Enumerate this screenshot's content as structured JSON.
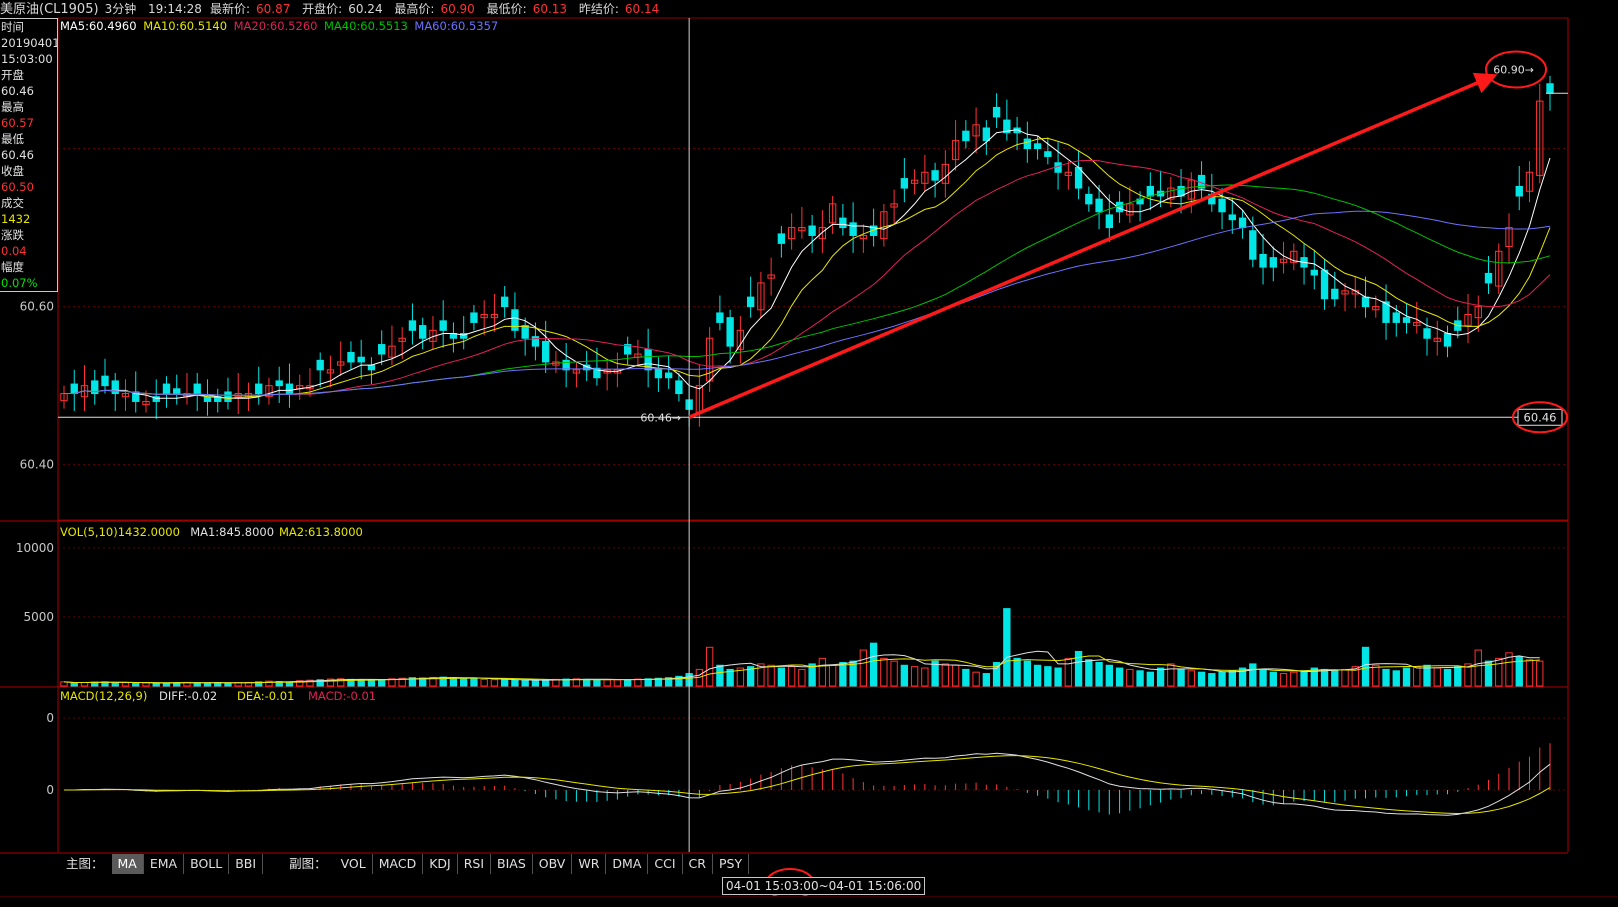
{
  "header": {
    "symbol": "美原油(CL1905)",
    "period": "3分钟",
    "clock": "19:14:28",
    "latest_label": "最新价:",
    "latest_value": "60.87",
    "open_label": "开盘价:",
    "open_value": "60.24",
    "high_label": "最高价:",
    "high_value": "60.90",
    "low_label": "最低价:",
    "low_value": "60.13",
    "prev_label": "昨结价:",
    "prev_value": "60.14"
  },
  "infobox": {
    "time_label": "时间",
    "date": "20190401",
    "time": "15:03:00",
    "open_label": "开盘",
    "open": "60.46",
    "high_label": "最高",
    "high": "60.57",
    "low_label": "最低",
    "low": "60.46",
    "close_label": "收盘",
    "close": "60.50",
    "vol_label": "成交",
    "vol": "1432",
    "chg_label": "涨跌",
    "chg": "0.04",
    "pct_label": "幅度",
    "pct": "0.07%"
  },
  "indicators": {
    "ma_line": [
      "MA5:60.4960",
      "MA10:60.5140",
      "MA20:60.5260",
      "MA40:60.5513",
      "MA60:60.5357"
    ],
    "vol_line": [
      "VOL(5,10)1432.0000",
      "MA1:845.8000",
      "MA2:613.8000"
    ],
    "macd_line": [
      "MACD(12,26,9)",
      "DIFF:-0.02",
      "DEA:-0.01",
      "MACD:-0.01"
    ]
  },
  "annotations": {
    "high_marker": "60.90",
    "cursor_marker": "60.46",
    "cursor_price_box": "60.46"
  },
  "colors": {
    "up": "#ff3232",
    "down": "#00e5e5",
    "ma5": "#ffffff",
    "ma10": "#e6e600",
    "ma20": "#e0205a",
    "ma40": "#00c000",
    "ma60": "#7070ff",
    "annotation": "#ff1a1a"
  },
  "bottom_tabs": {
    "main_label": "主图：",
    "main": [
      "MA",
      "EMA",
      "BOLL",
      "BBI"
    ],
    "sub_label": "副图：",
    "sub": [
      "VOL",
      "MACD",
      "KDJ",
      "RSI",
      "BIAS",
      "OBV",
      "WR",
      "DMA",
      "CCI",
      "CR",
      "PSY"
    ]
  },
  "time_range": "04-01 15:03:00~04-01 15:06:00",
  "chart_data": {
    "type": "candlestick",
    "price_axis": {
      "ticks": [
        "60.60",
        "60.40"
      ]
    },
    "vol_axis": {
      "ticks": [
        "10000",
        "5000"
      ]
    },
    "macd_axis": {
      "ticks": [
        "0",
        "0"
      ]
    },
    "price_range": [
      60.33,
      60.95
    ],
    "vol_range": [
      0,
      11000
    ],
    "candles_close": [
      60.49,
      60.49,
      60.5,
      60.49,
      60.5,
      60.49,
      60.49,
      60.48,
      60.48,
      60.48,
      60.49,
      60.49,
      60.49,
      60.49,
      60.48,
      60.48,
      60.48,
      60.49,
      60.49,
      60.49,
      60.5,
      60.5,
      60.49,
      60.5,
      60.5,
      60.52,
      60.52,
      60.53,
      60.53,
      60.53,
      60.52,
      60.54,
      60.55,
      60.56,
      60.57,
      60.56,
      60.57,
      60.57,
      60.56,
      60.56,
      60.58,
      60.59,
      60.59,
      60.6,
      60.57,
      60.56,
      60.55,
      60.53,
      60.53,
      60.52,
      60.52,
      60.52,
      60.51,
      60.52,
      60.52,
      60.54,
      60.54,
      60.52,
      60.51,
      60.51,
      60.49,
      60.47,
      60.5,
      60.56,
      60.58,
      60.55,
      60.57,
      60.6,
      60.63,
      60.64,
      60.68,
      60.7,
      60.7,
      60.69,
      60.7,
      60.73,
      60.7,
      60.69,
      60.69,
      60.69,
      60.72,
      60.73,
      60.75,
      60.76,
      60.77,
      60.76,
      60.78,
      60.81,
      60.81,
      60.83,
      60.81,
      60.84,
      60.82,
      60.82,
      60.8,
      60.8,
      60.79,
      60.77,
      60.77,
      60.75,
      60.73,
      60.72,
      60.7,
      60.72,
      60.73,
      60.73,
      60.74,
      60.74,
      60.75,
      60.74,
      60.76,
      60.75,
      60.73,
      60.72,
      60.71,
      60.7,
      60.66,
      60.65,
      60.65,
      60.66,
      60.67,
      60.65,
      60.64,
      60.61,
      60.61,
      60.62,
      60.62,
      60.6,
      60.6,
      60.58,
      60.58,
      60.58,
      60.58,
      60.56,
      60.56,
      60.55,
      60.57,
      60.59,
      60.6,
      60.63,
      60.67,
      60.7,
      60.74,
      60.77,
      60.86,
      60.87
    ],
    "volume": [
      300,
      200,
      250,
      280,
      300,
      260,
      240,
      200,
      220,
      210,
      230,
      250,
      260,
      240,
      230,
      250,
      220,
      240,
      260,
      300,
      350,
      320,
      300,
      380,
      420,
      450,
      500,
      520,
      480,
      450,
      430,
      470,
      520,
      560,
      600,
      580,
      620,
      640,
      600,
      580,
      520,
      480,
      460,
      440,
      420,
      400,
      420,
      450,
      480,
      500,
      520,
      480,
      460,
      450,
      440,
      460,
      500,
      520,
      560,
      600,
      700,
      900,
      1200,
      2800,
      1500,
      1200,
      1300,
      1400,
      1600,
      1500,
      1300,
      1400,
      1200,
      1600,
      2000,
      1500,
      1700,
      1800,
      2600,
      3100,
      2000,
      1800,
      1500,
      1400,
      1300,
      1800,
      1600,
      1500,
      1200,
      1000,
      900,
      1700,
      5600,
      2000,
      1800,
      1500,
      1400,
      1300,
      2000,
      2500,
      1900,
      1700,
      1500,
      1300,
      1200,
      1100,
      1000,
      1300,
      1600,
      1200,
      1100,
      1000,
      900,
      1000,
      1100,
      1300,
      1600,
      1200,
      1000,
      900,
      1000,
      1100,
      1300,
      1200,
      1100,
      1200,
      1400,
      2800,
      1500,
      1200,
      1100,
      1300,
      1400,
      1500,
      1300,
      1200,
      1400,
      1600,
      2600,
      1800,
      2000,
      2400,
      2100,
      1900,
      1800
    ]
  }
}
